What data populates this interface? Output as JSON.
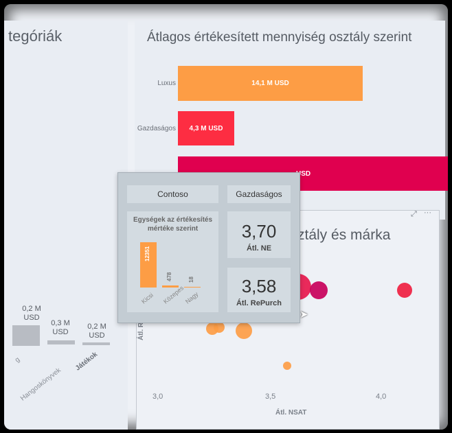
{
  "left_panel": {
    "title": "tegóriák",
    "values": [
      "0,2 M\nUSD",
      "0,3 M\nUSD",
      "0,2 M\nUSD"
    ],
    "value_a": "0,2 M",
    "value_a_unit": "USD",
    "value_b": "0,3 M",
    "value_b_unit": "USD",
    "value_c": "0,2 M",
    "value_c_unit": "USD",
    "cat_a": "g",
    "cat_b": "Hangoskönyvek",
    "cat_c": "Játékok"
  },
  "bar_chart": {
    "title": "Átlagos értékesített mennyiség osztály szerint",
    "colors": {
      "luxus": "#fd9d45",
      "gazdasagos": "#fd2d42",
      "third": "#e0004f"
    }
  },
  "scatter": {
    "title": "ztály és márka",
    "x_ticks": [
      "3,0",
      "3,5",
      "4,0"
    ],
    "y_label": "Átl. Re",
    "x_label": "Átl. NSAT"
  },
  "tooltip": {
    "brand": "Contoso",
    "class": "Gazdaságos",
    "mini_chart_title_1": "Egységek az értékesítés",
    "mini_chart_title_2": "mértéke szerint",
    "kpi1_value": "3,70",
    "kpi1_label": "Átl. NE",
    "kpi2_value": "3,58",
    "kpi2_label": "Átl. RePurch"
  },
  "chart_data": [
    {
      "type": "bar",
      "title": "Átlagos értékesített mennyiség osztály szerint",
      "categories": [
        "Luxus",
        "Gazdaságos",
        ""
      ],
      "values": [
        14.1,
        4.3,
        21
      ],
      "data_labels": [
        "14,1 M USD",
        "4,3 M USD",
        "USD"
      ],
      "xlim": [
        0,
        22
      ]
    },
    {
      "type": "bar",
      "title": "Egységek az értékesítés mértéke szerint",
      "categories": [
        "Kicsi",
        "Közepes",
        "Nagy"
      ],
      "values": [
        12351,
        478,
        18
      ],
      "data_labels": [
        "12351",
        "478",
        "18"
      ],
      "color": "#fd9d45"
    },
    {
      "type": "scatter",
      "xlabel": "Átl. NSAT",
      "ylabel": "Átl. Re",
      "xlim": [
        2.9,
        4.2
      ],
      "x_ticks": [
        "3,0",
        "3,5",
        "4,0"
      ],
      "points": [
        {
          "x": 3.62,
          "y": 3.58,
          "r": 19,
          "color": "#e8194d"
        },
        {
          "x": 3.55,
          "y": 3.55,
          "r": 12,
          "color": "#d8005a"
        },
        {
          "x": 3.5,
          "y": 3.54,
          "r": 12,
          "color": "#fd2d42"
        },
        {
          "x": 3.6,
          "y": 3.62,
          "r": 8,
          "color": "#fd9d45"
        },
        {
          "x": 3.58,
          "y": 3.56,
          "r": 7,
          "color": "#fd9d45"
        },
        {
          "x": 3.71,
          "y": 3.56,
          "r": 13,
          "color": "#c8005a"
        },
        {
          "x": 4.09,
          "y": 3.56,
          "r": 11,
          "color": "#ef2040"
        },
        {
          "x": 3.38,
          "y": 3.33,
          "r": 12,
          "color": "#fd9d45"
        },
        {
          "x": 3.24,
          "y": 3.34,
          "r": 9,
          "color": "#fd9d45"
        },
        {
          "x": 3.27,
          "y": 3.35,
          "r": 8,
          "color": "#fd9d45"
        },
        {
          "x": 3.57,
          "y": 3.13,
          "r": 6,
          "color": "#fd9d45"
        }
      ]
    }
  ]
}
